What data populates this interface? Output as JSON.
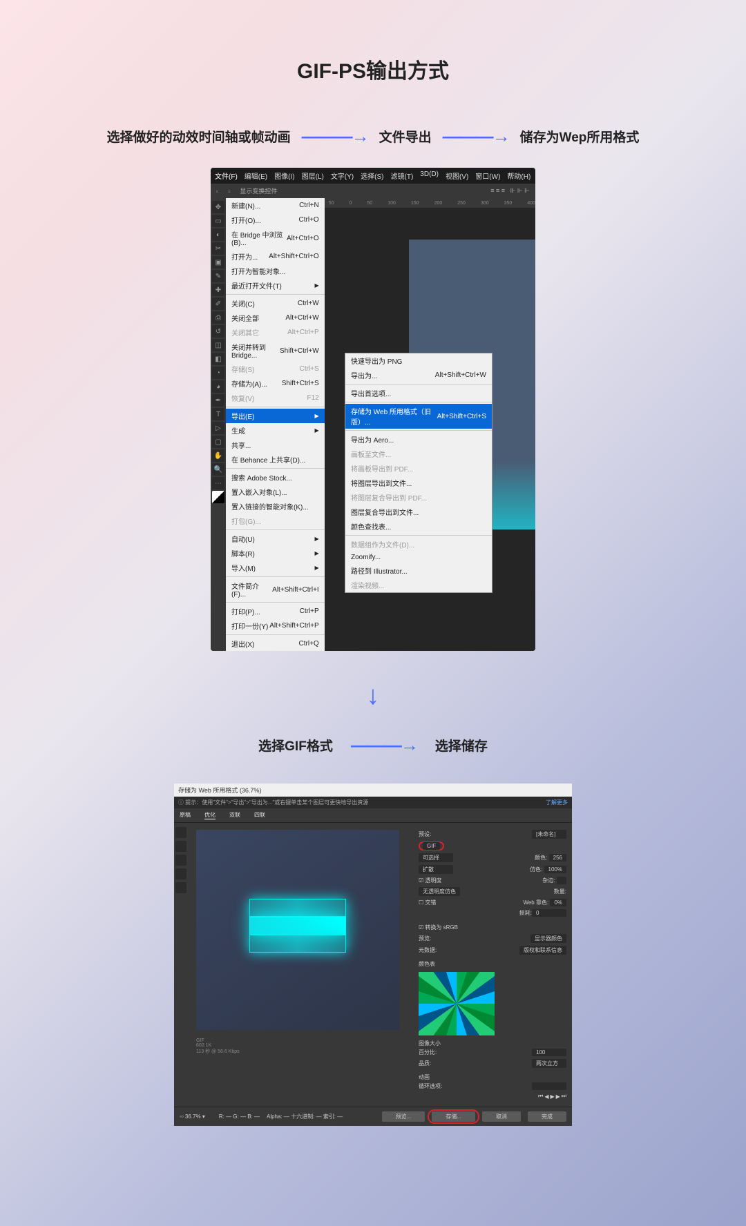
{
  "title": "GIF-PS输出方式",
  "steps_top": [
    "选择做好的动效时间轴或帧动画",
    "文件导出",
    "储存为Wep所用格式"
  ],
  "steps_bottom": [
    "选择GIF格式",
    "选择储存"
  ],
  "ps_menubar": [
    "文件(F)",
    "编辑(E)",
    "图像(I)",
    "图层(L)",
    "文字(Y)",
    "选择(S)",
    "滤镜(T)",
    "3D(D)",
    "视图(V)",
    "窗口(W)",
    "帮助(H)"
  ],
  "ps_toolbar_hint": "显示变换控件",
  "ps_ruler_marks": [
    "50",
    "0",
    "50",
    "100",
    "150",
    "200",
    "250",
    "300",
    "350",
    "400"
  ],
  "file_menu": [
    {
      "label": "新建(N)...",
      "shortcut": "Ctrl+N"
    },
    {
      "label": "打开(O)...",
      "shortcut": "Ctrl+O"
    },
    {
      "label": "在 Bridge 中浏览(B)...",
      "shortcut": "Alt+Ctrl+O"
    },
    {
      "label": "打开为...",
      "shortcut": "Alt+Shift+Ctrl+O"
    },
    {
      "label": "打开为智能对象..."
    },
    {
      "label": "最近打开文件(T)",
      "arrow": true
    },
    {
      "sep": true
    },
    {
      "label": "关闭(C)",
      "shortcut": "Ctrl+W"
    },
    {
      "label": "关闭全部",
      "shortcut": "Alt+Ctrl+W"
    },
    {
      "label": "关闭其它",
      "shortcut": "Alt+Ctrl+P",
      "disabled": true
    },
    {
      "label": "关闭并转到 Bridge...",
      "shortcut": "Shift+Ctrl+W"
    },
    {
      "label": "存储(S)",
      "shortcut": "Ctrl+S",
      "disabled": true
    },
    {
      "label": "存储为(A)...",
      "shortcut": "Shift+Ctrl+S"
    },
    {
      "label": "恢复(V)",
      "shortcut": "F12",
      "disabled": true
    },
    {
      "sep": true
    },
    {
      "label": "导出(E)",
      "arrow": true,
      "hl": true
    },
    {
      "label": "生成",
      "arrow": true
    },
    {
      "label": "共享..."
    },
    {
      "label": "在 Behance 上共享(D)..."
    },
    {
      "sep": true
    },
    {
      "label": "搜索 Adobe Stock..."
    },
    {
      "label": "置入嵌入对象(L)..."
    },
    {
      "label": "置入链接的智能对象(K)..."
    },
    {
      "label": "打包(G)...",
      "disabled": true
    },
    {
      "sep": true
    },
    {
      "label": "自动(U)",
      "arrow": true
    },
    {
      "label": "脚本(R)",
      "arrow": true
    },
    {
      "label": "导入(M)",
      "arrow": true
    },
    {
      "sep": true
    },
    {
      "label": "文件简介(F)...",
      "shortcut": "Alt+Shift+Ctrl+I"
    },
    {
      "sep": true
    },
    {
      "label": "打印(P)...",
      "shortcut": "Ctrl+P"
    },
    {
      "label": "打印一份(Y)",
      "shortcut": "Alt+Shift+Ctrl+P"
    },
    {
      "sep": true
    },
    {
      "label": "退出(X)",
      "shortcut": "Ctrl+Q"
    }
  ],
  "export_submenu": [
    {
      "label": "快速导出为 PNG"
    },
    {
      "label": "导出为...",
      "shortcut": "Alt+Shift+Ctrl+W"
    },
    {
      "sep": true
    },
    {
      "label": "导出首选项..."
    },
    {
      "sep": true
    },
    {
      "label": "存储为 Web 所用格式（旧版）...",
      "shortcut": "Alt+Shift+Ctrl+S",
      "hl": true
    },
    {
      "sep": true
    },
    {
      "label": "导出为 Aero..."
    },
    {
      "label": "画板至文件...",
      "disabled": true
    },
    {
      "label": "将画板导出到 PDF...",
      "disabled": true
    },
    {
      "label": "将图层导出到文件..."
    },
    {
      "label": "将图层复合导出到 PDF...",
      "disabled": true
    },
    {
      "label": "图层复合导出到文件..."
    },
    {
      "label": "颜色查找表..."
    },
    {
      "sep": true
    },
    {
      "label": "数据组作为文件(D)...",
      "disabled": true
    },
    {
      "label": "Zoomify..."
    },
    {
      "label": "路径到 Illustrator..."
    },
    {
      "label": "渲染视频...",
      "disabled": true
    }
  ],
  "save_dialog": {
    "title": "存储为 Web 所用格式 (36.7%)",
    "tip": "提示：使用\"文件\">\"导出\">\"导出为...\"或右键单击某个图层可更快地导出资源",
    "learn": "了解更多",
    "tabs": [
      "原稿",
      "优化",
      "双联",
      "四联"
    ],
    "preset_label": "预设:",
    "preset_value": "[未命名]",
    "format": "GIF",
    "algo_label": "可选择",
    "colors_label": "颜色:",
    "colors": "256",
    "dither_label": "扩散",
    "dither_amt_label": "仿色:",
    "dither_amt": "100%",
    "transparency": "透明度",
    "matte_label": "杂边:",
    "no_dither": "无透明度仿色",
    "amount_label": "数量:",
    "interlaced": "交错",
    "web_label": "Web 靠色:",
    "web": "0%",
    "loss_label": "损耗:",
    "loss": "0",
    "convert_srgb": "转换为 sRGB",
    "preview_label": "预览:",
    "preview_value": "显示器颜色",
    "metadata_label": "元数据:",
    "metadata_value": "版权和联系信息",
    "color_table": "颜色表",
    "image_size": "图像大小",
    "percent": "百分比:",
    "quality": "品质:",
    "quality_value": "两次立方",
    "animation": "动画",
    "loop_label": "循环选项:",
    "info_left": "GIF\n602.1K\n113 秒 @ 56.6 Kbps",
    "alpha": "Alpha:",
    "hex": "十六进制:",
    "r": "R:",
    "g": "G:",
    "b:": "B:",
    "index": "索引:",
    "buttons": [
      "预览...",
      "存储...",
      "取消",
      "完成"
    ]
  }
}
